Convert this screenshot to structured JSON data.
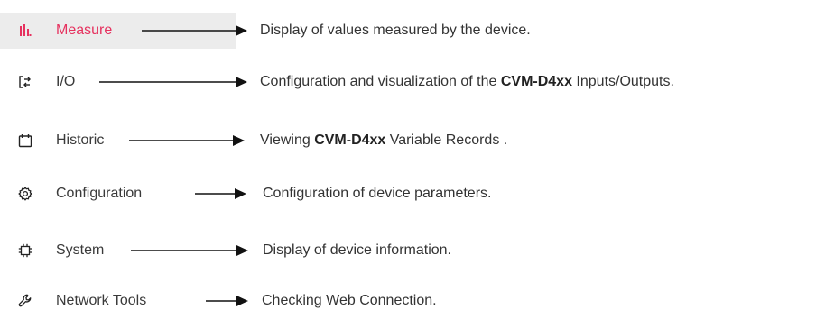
{
  "accent_color": "#e6325f",
  "nav": [
    {
      "label": "Measure",
      "icon": "bar-chart-icon",
      "active": true,
      "desc_before": "Display of values measured by the device.",
      "desc_bold": "",
      "desc_after": ""
    },
    {
      "label": "I/O",
      "icon": "input-output-icon",
      "active": false,
      "desc_before": "Configuration and visualization of the ",
      "desc_bold": "CVM-D4xx",
      "desc_after": " Inputs/Outputs."
    },
    {
      "label": "Historic",
      "icon": "calendar-icon",
      "active": false,
      "desc_before": "Viewing ",
      "desc_bold": "CVM-D4xx",
      "desc_after": " Variable Records ."
    },
    {
      "label": "Configuration",
      "icon": "gear-icon",
      "active": false,
      "desc_before": "Configuration of device parameters.",
      "desc_bold": "",
      "desc_after": ""
    },
    {
      "label": "System",
      "icon": "chip-icon",
      "active": false,
      "desc_before": "Display of device information.",
      "desc_bold": "",
      "desc_after": ""
    },
    {
      "label": "Network Tools",
      "icon": "wrench-icon",
      "active": false,
      "desc_before": "Checking Web Connection.",
      "desc_bold": "",
      "desc_after": ""
    }
  ]
}
